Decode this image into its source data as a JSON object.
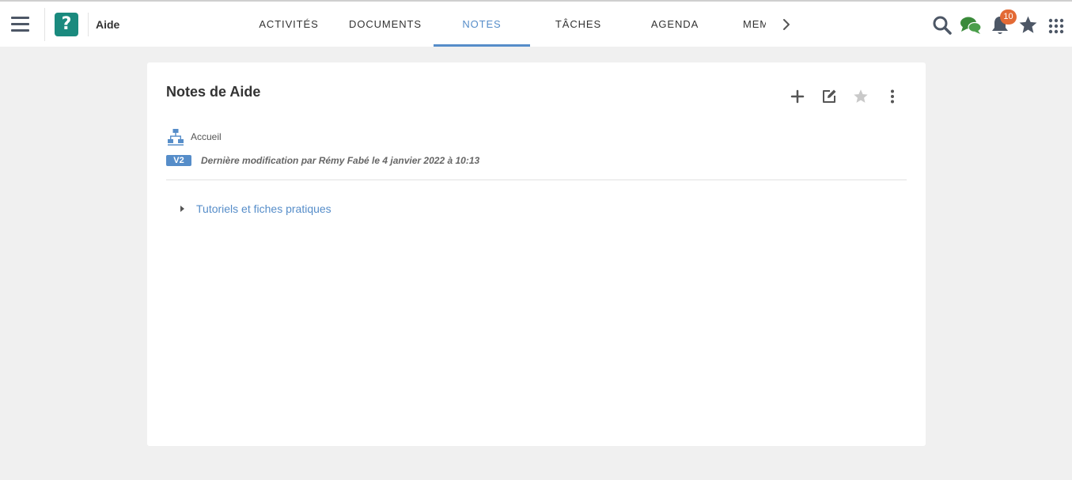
{
  "topbar": {
    "space_name": "Aide",
    "logo_glyph": "?",
    "logo_color": "#1a8a7e",
    "tabs": [
      {
        "label": "ACTIVITÉS",
        "active": false
      },
      {
        "label": "DOCUMENTS",
        "active": false
      },
      {
        "label": "NOTES",
        "active": true
      },
      {
        "label": "TÂCHES",
        "active": false
      },
      {
        "label": "AGENDA",
        "active": false
      },
      {
        "label": "MEMBRES",
        "active": false
      }
    ],
    "notification_count": "10",
    "icons": [
      "menu-icon",
      "search-icon",
      "chat-icon",
      "bell-icon",
      "star-icon",
      "apps-grid-icon"
    ]
  },
  "colors": {
    "accent": "#568dc9",
    "badge": "#e36a35",
    "icon": "#4d5766",
    "chat": "#3a8a3a"
  },
  "notes": {
    "title": "Notes de Aide",
    "breadcrumb": "Accueil",
    "version": "V2",
    "last_modified": "Dernière modification par Rémy Fabé le 4 janvier 2022 à 10:13",
    "actions": [
      "add-icon",
      "edit-icon",
      "star-icon",
      "more-vertical-icon"
    ],
    "tree": [
      {
        "label": "Tutoriels et fiches pratiques",
        "expanded": false
      }
    ]
  }
}
